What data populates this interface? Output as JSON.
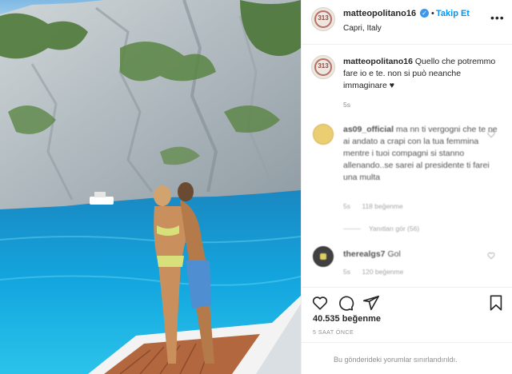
{
  "post": {
    "username": "matteopolitano16",
    "verified_mark": "✓",
    "separator": "•",
    "follow_label": "Takip Et",
    "location": "Capri, Italy",
    "more_label": "•••",
    "avatar_text": "313"
  },
  "caption": {
    "username": "matteopolitano16",
    "text": "Quello che potremmo fare io e te. non si può neanche immaginare ♥",
    "age": "5s"
  },
  "comments": [
    {
      "username": "as09_official",
      "text": "ma nn ti vergogni che te ne ai andato a crapi con la tua femmina mentre i tuoi compagni si stanno allenando..se sarei al presidente ti farei una multa",
      "age": "5s",
      "likes": "118 beğenme",
      "view_replies": "Yanıtları gör (56)"
    },
    {
      "username": "therealgs7",
      "text": "Gol",
      "age": "5s",
      "likes": "120 beğenme"
    }
  ],
  "actions": {
    "like_icon": "heart-icon",
    "comment_icon": "comment-icon",
    "share_icon": "send-icon",
    "save_icon": "bookmark-icon"
  },
  "likes_count": "40.535 beğenme",
  "timestamp": "5 SAAT ÖNCE",
  "comments_limited": "Bu gönderideki yorumlar sınırlandırıldı."
}
